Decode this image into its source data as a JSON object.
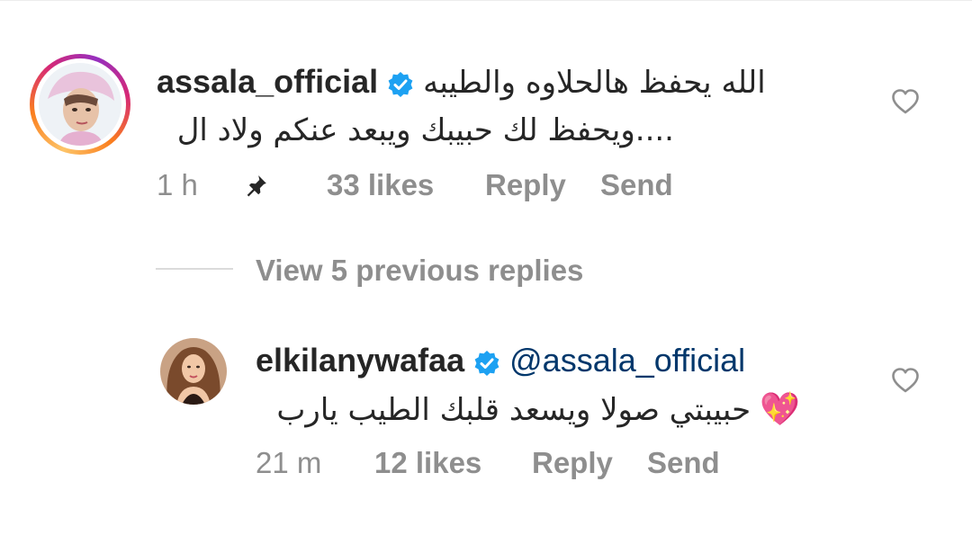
{
  "comments": [
    {
      "username": "assala_official",
      "text_line1": "الله يحفظ هالحلاوه والطيبه",
      "text_line2": "....ويحفظ لك حبيبك ويبعد عنكم ولاد ال",
      "time": "1 h",
      "likes": "33 likes",
      "reply_label": "Reply",
      "send_label": "Send",
      "pinned": true
    },
    {
      "username": "elkilanywafaa",
      "mention": "@assala_official",
      "emoji": "💖",
      "text": "حبيبتي صولا ويسعد قلبك الطيب يارب",
      "time": "21 m",
      "likes": "12 likes",
      "reply_label": "Reply",
      "send_label": "Send"
    }
  ],
  "view_replies_label": "View 5 previous replies",
  "colors": {
    "text": "#262626",
    "secondary": "#8e8e8e",
    "verified": "#1da1f2",
    "mention": "#00376b"
  }
}
